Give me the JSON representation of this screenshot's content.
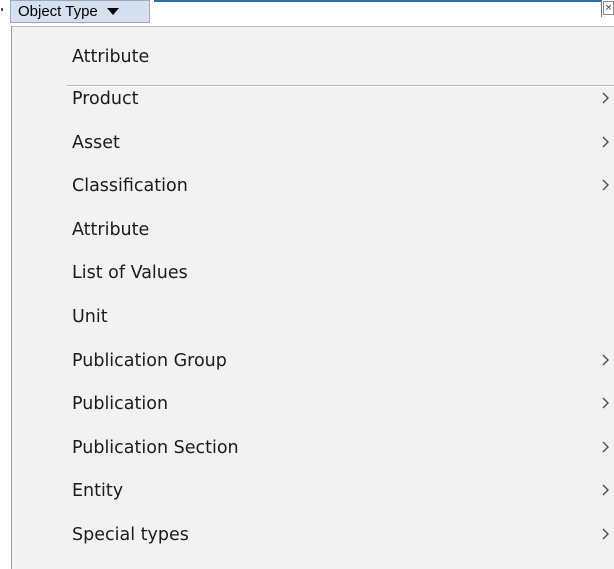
{
  "toolbar": {
    "dropdown_label": "Object Type",
    "close_glyph": "×"
  },
  "menu": {
    "header_item": {
      "label": "Attribute",
      "submenu": false
    },
    "items": [
      {
        "label": "Product",
        "submenu": true
      },
      {
        "label": "Asset",
        "submenu": true
      },
      {
        "label": "Classification",
        "submenu": true
      },
      {
        "label": "Attribute",
        "submenu": false
      },
      {
        "label": "List of Values",
        "submenu": false
      },
      {
        "label": "Unit",
        "submenu": false
      },
      {
        "label": "Publication Group",
        "submenu": true
      },
      {
        "label": "Publication",
        "submenu": true
      },
      {
        "label": "Publication Section",
        "submenu": true
      },
      {
        "label": "Entity",
        "submenu": true
      },
      {
        "label": "Special types",
        "submenu": true
      }
    ]
  },
  "icons": {
    "dropdown_caret": "caret-down-icon",
    "submenu_arrow": "chevron-right-icon",
    "close": "close-icon"
  },
  "colors": {
    "dropdown_bg": "#d4dff0",
    "field_border": "#2b6cb0",
    "menu_bg": "#f2f2f2",
    "separator": "#b7b7b7"
  }
}
